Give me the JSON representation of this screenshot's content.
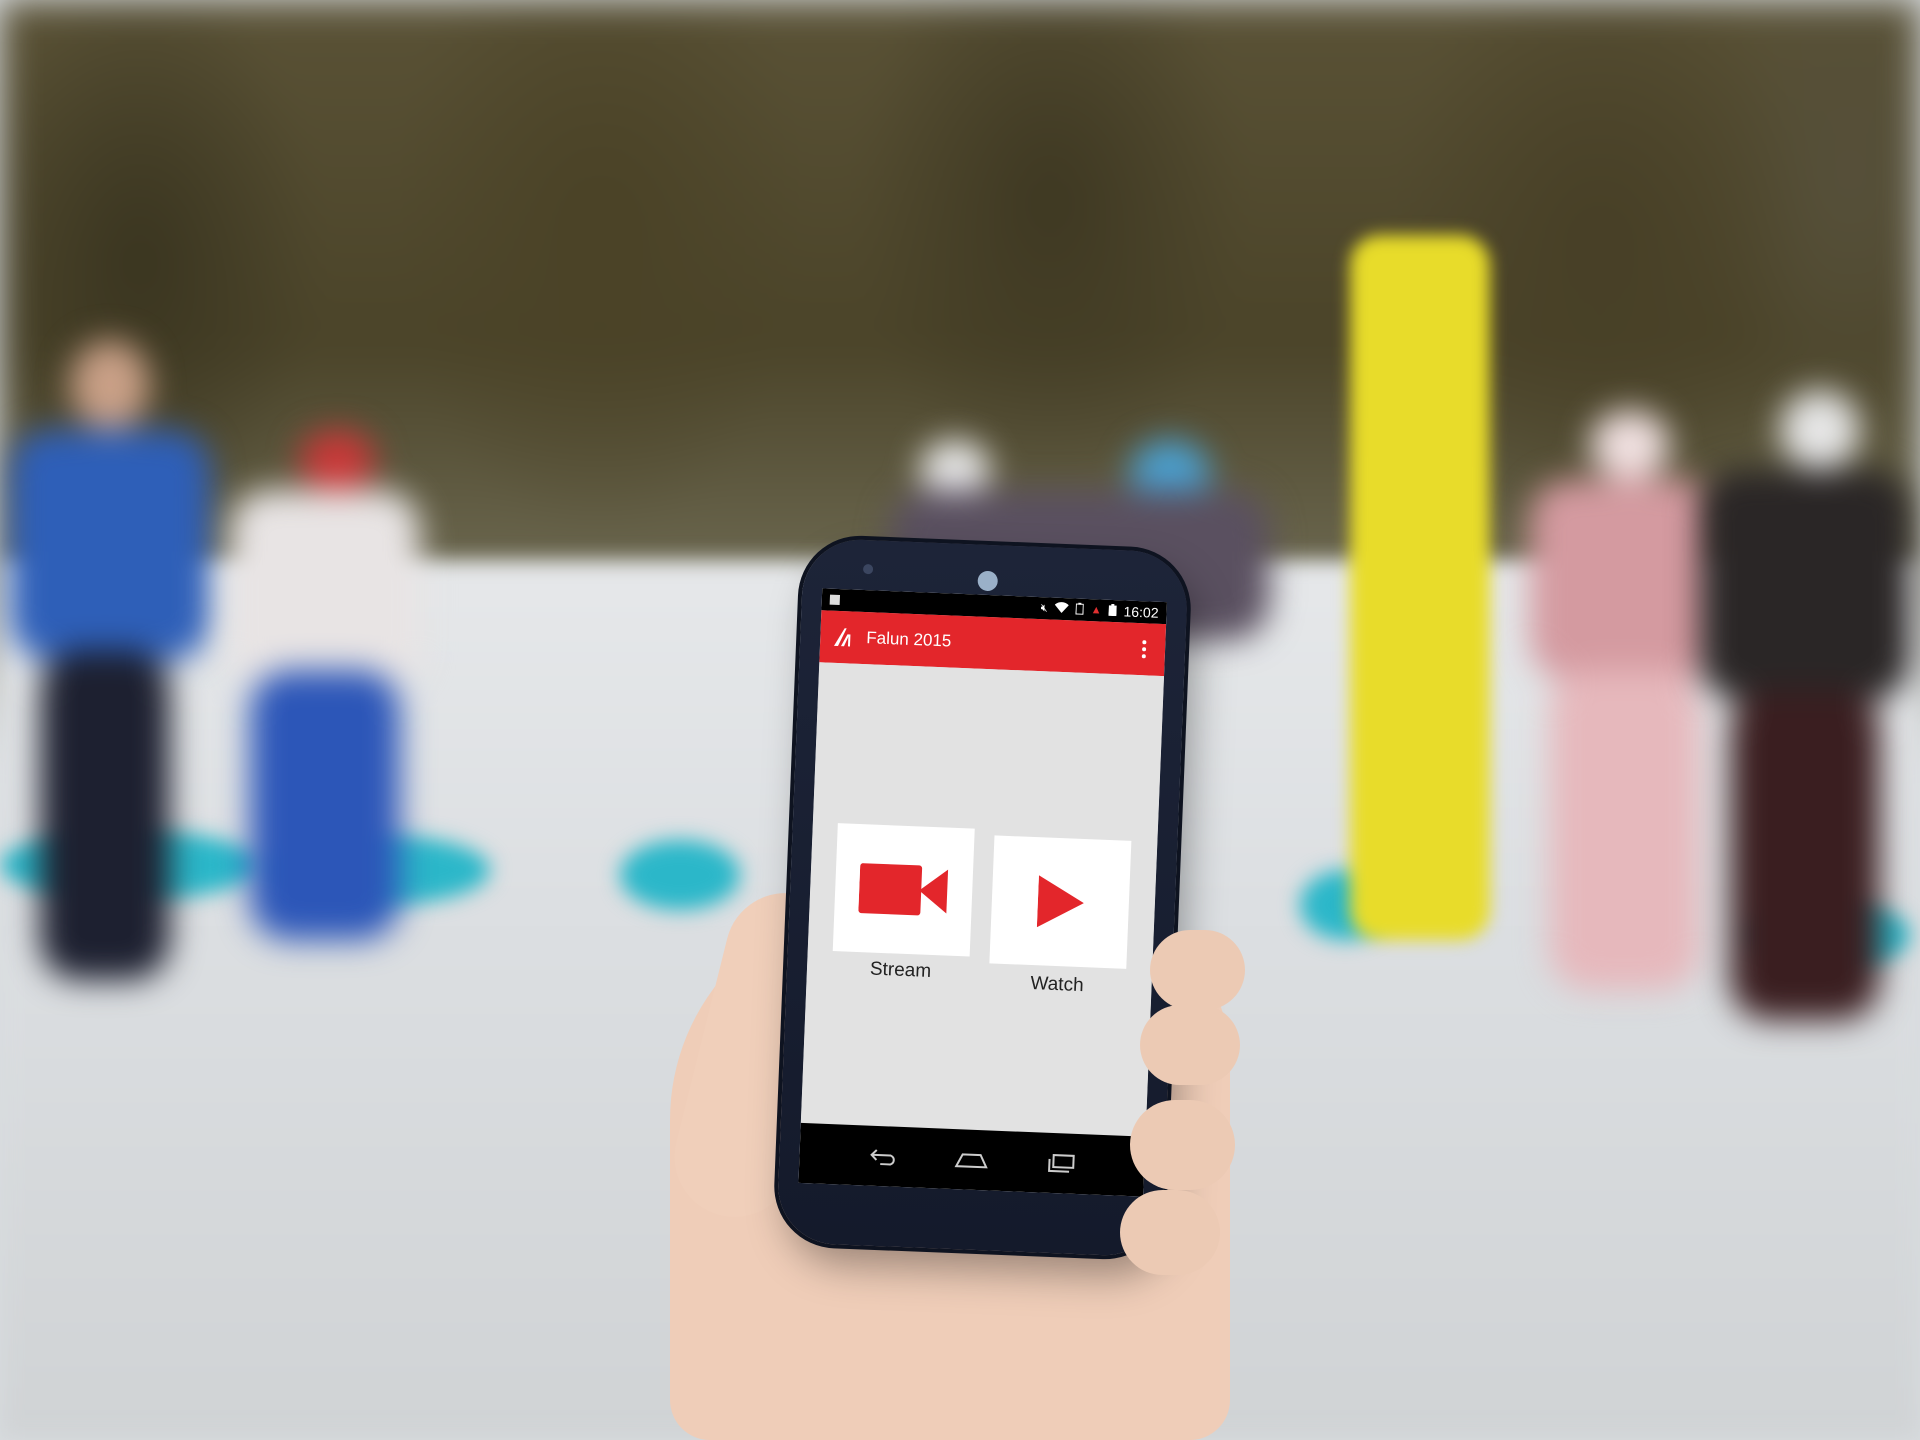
{
  "status_bar": {
    "time": "16:02",
    "icons": [
      "notification-icon",
      "mute-icon",
      "wifi-icon",
      "battery-saver-icon",
      "alert-icon",
      "battery-icon"
    ]
  },
  "app_bar": {
    "title": "Falun 2015",
    "logo": "app-logo-icon",
    "menu": "overflow-menu-icon",
    "color": "#e3262b"
  },
  "actions": {
    "stream_label": "Stream",
    "watch_label": "Watch",
    "stream_icon": "video-camera-icon",
    "watch_icon": "play-icon",
    "accent": "#e3262b"
  },
  "nav_bar": {
    "buttons": [
      "back-icon",
      "home-icon",
      "recents-icon"
    ]
  }
}
